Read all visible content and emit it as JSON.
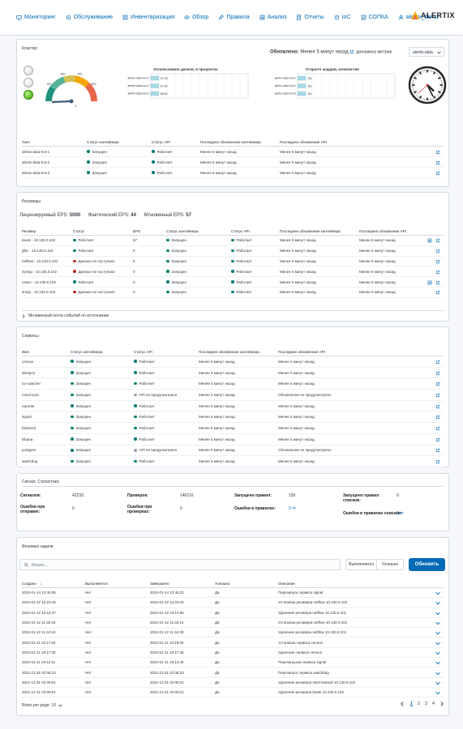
{
  "nav": {
    "items": [
      {
        "label": "Мониторинг",
        "icon": "monitor-icon"
      },
      {
        "label": "Обслуживание",
        "icon": "wrench-icon"
      },
      {
        "label": "Инвентаризация",
        "icon": "inventory-icon"
      },
      {
        "label": "Обзор",
        "icon": "eye-icon"
      },
      {
        "label": "Правила",
        "icon": "pencil-icon"
      },
      {
        "label": "Анализ",
        "icon": "analysis-icon"
      },
      {
        "label": "Отчеты",
        "icon": "report-icon"
      },
      {
        "label": "IoC",
        "icon": "ioc-icon"
      },
      {
        "label": "СОПКА",
        "icon": "sopka-icon"
      },
      {
        "label": "alertix_demo",
        "icon": "user-icon"
      }
    ],
    "brand": "ALERTIX",
    "colors": {
      "link": "#006bb4",
      "brand_orange": "#f5a700",
      "brand_red": "#e7664c"
    }
  },
  "cluster": {
    "title": "Кластер",
    "updated_label": "Обновлено:",
    "updated_value": "Менее 5 минут назад",
    "dynamics_label": "динамика метрик",
    "select_value": "alertix-data",
    "gauge": {
      "ticks": [
        "200",
        "400",
        "600",
        "800"
      ],
      "min_label": "0",
      "value": 0
    },
    "disk_chart": {
      "title": "Использовано дисков, в процентах",
      "categories": [
        "alertix-data-hot-1",
        "alertix-data-hot-2",
        "alertix-data-hot-3"
      ],
      "values": [
        "57.90",
        "57.60",
        "56.60"
      ]
    },
    "shard_chart": {
      "title": "Открыто шардов, количество",
      "categories": [
        "alertix-data-hot-1",
        "alertix-data-hot-2",
        "alertix-data-hot-3"
      ],
      "values": [
        "151",
        "151",
        "151"
      ]
    },
    "clock": {
      "hour": 4,
      "minute": 25,
      "second": 38
    },
    "headers": [
      "Узел",
      "Статус контейнера",
      "Статус API",
      "Последнее обновление контейнера",
      "Последнее обновление API"
    ],
    "rows": [
      [
        "alertix-data-hot-1",
        "Запущен",
        "Работает",
        "Менее 5 минут назад",
        "Менее 5 минут назад"
      ],
      [
        "alertix-data-hot-2",
        "Запущен",
        "Работает",
        "Менее 5 минут назад",
        "Менее 5 минут назад"
      ],
      [
        "alertix-data-hot-3",
        "Запущен",
        "Работает",
        "Менее 5 минут назад",
        "Менее 5 минут назад"
      ]
    ]
  },
  "receivers": {
    "title": "Ресиверы",
    "licensed_label": "Лицензируемый EPS:",
    "licensed_value": "5000",
    "actual_label": "Фактический EPS:",
    "actual_value": "44",
    "instant_label": "Мгновенный EPS:",
    "instant_value": "57",
    "headers": [
      "Ресивер",
      "Статус",
      "EPS",
      "Статус контейнера",
      "Статус API",
      "Последнее обновление контейнера",
      "Последнее обновление API"
    ],
    "rows": [
      {
        "cells": [
          "beats - 10.130.0.102",
          "Работает",
          "57",
          "Запущен",
          "Работает",
          "Менее 5 минут назад",
          "Менее 5 минут назад"
        ],
        "status": "ok",
        "extra_icon": true
      },
      {
        "cells": [
          "jdbc - 10.130.0.102",
          "Работает",
          "0",
          "Запущен",
          "Работает",
          "Менее 5 минут назад",
          "Менее 5 минут назад"
        ],
        "status": "ok",
        "extra_icon": false
      },
      {
        "cells": [
          "netflow - 10.130.0.102",
          "Данные не поступают",
          "0",
          "Запущен",
          "Работает",
          "Менее 5 минут назад",
          "Менее 5 минут назад"
        ],
        "status": "err",
        "extra_icon": false
      },
      {
        "cells": [
          "syslog - 10.130.0.102",
          "Данные не поступают",
          "0",
          "Запущен",
          "Работает",
          "Менее 5 минут назад",
          "Менее 5 минут назад"
        ],
        "status": "err",
        "extra_icon": false
      },
      {
        "cells": [
          "ossec - 10.130.0.102",
          "Работает",
          "0",
          "Запущен",
          "Работает",
          "Менее 5 минут назад",
          "Менее 5 минут назад"
        ],
        "status": "ok",
        "extra_icon": true
      },
      {
        "cells": [
          "snmp - 10.130.0.102",
          "Данные не поступают",
          "0",
          "Запущен",
          "Работает",
          "Менее 5 минут назад",
          "Менее 5 минут назад"
        ],
        "status": "err",
        "extra_icon": false
      }
    ],
    "stream_label": "Мгновенный поток событий по источникам"
  },
  "services": {
    "title": "Сервисы",
    "headers": [
      "Имя",
      "Статус контейнера",
      "Статус API",
      "Последнее обновление контейнера",
      "Последнее обновление API"
    ],
    "rows": [
      {
        "cells": [
          "census",
          "Запущен",
          "Работает",
          "Менее 5 минут назад",
          "Менее 5 минут назад"
        ],
        "api": "ok"
      },
      {
        "cells": [
          "alertprix",
          "Запущен",
          "Работает",
          "Менее 5 минут назад",
          "Менее 5 минут назад"
        ],
        "api": "ok"
      },
      {
        "cells": [
          "ioc-watcher",
          "Запущен",
          "Работает",
          "Менее 5 минут назад",
          "Менее 5 минут назад"
        ],
        "api": "ok"
      },
      {
        "cells": [
          "mssd-sync",
          "Запущен",
          "API не предусмотрено",
          "Менее 5 минут назад",
          "Обновление не предусмотрено"
        ],
        "api": "na"
      },
      {
        "cells": [
          "reporter",
          "Запущен",
          "Работает",
          "Менее 5 минут назад",
          "Менее 5 минут назад"
        ],
        "api": "ok"
      },
      {
        "cells": [
          "signal",
          "Запущен",
          "Работает",
          "Менее 5 минут назад",
          "Менее 5 минут назад"
        ],
        "api": "ok"
      },
      {
        "cells": [
          "backend",
          "Запущен",
          "Работает",
          "Менее 5 минут назад",
          "Менее 5 минут назад"
        ],
        "api": "ok"
      },
      {
        "cells": [
          "kibana",
          "Запущен",
          "Работает",
          "Менее 5 минут назад",
          "Менее 5 минут назад"
        ],
        "api": "ok"
      },
      {
        "cells": [
          "postgres",
          "Запущен",
          "API не предусмотрено",
          "Менее 5 минут назад",
          "Обновление не предусмотрено"
        ],
        "api": "na"
      },
      {
        "cells": [
          "watchdog",
          "Запущен",
          "Работает",
          "Менее 5 минут назад",
          "Менее 5 минут назад"
        ],
        "api": "ok"
      }
    ]
  },
  "signal_stats": {
    "title": "Сигнал. Статистика",
    "signals_label": "Сигналов:",
    "signals_value": "42233",
    "checks_label": "Проверок:",
    "checks_value": "146216",
    "rules_started_label": "Запущено правил:",
    "rules_started_value": "156",
    "rule_lists_label": "Запущено правил списков:",
    "rule_lists_value": "0",
    "send_errors_label": "Ошибки при отправке:",
    "send_errors_value": "0",
    "check_errors_label": "Ошибки при проверках:",
    "check_errors_value": "0",
    "rule_errors_label": "Ошибки в правилах:",
    "rule_errors_value": "0",
    "list_errors_label": "Ошибки в правилах списков:",
    "list_errors_value": "0"
  },
  "bg_tasks": {
    "title": "Фоновые задачи",
    "search_placeholder": "Искать ...",
    "filter_running": "Выполняется",
    "filter_success": "Успешно",
    "refresh_label": "Обновить",
    "headers": [
      "Создано",
      "Выполняется",
      "Завершено",
      "Успешно",
      "Описание"
    ],
    "sort_arrow": "↓",
    "rows": [
      [
        "2022-01-14 13:45:06",
        "Нет",
        "2022-01-14 13:45:22",
        "Да",
        "Перезапуск сервиса signal"
      ],
      [
        "2022-01-12 12:23:18",
        "Нет",
        "2022-01-12 12:23:44",
        "Да",
        "Установка ресивера netflow 10.130.0.102"
      ],
      [
        "2022-01-12 12:14:47",
        "Нет",
        "2022-01-12 12:14:55",
        "Да",
        "Удаление ресивера netflow 10.130.0.101"
      ],
      [
        "2022-01-12 11:45:18",
        "Нет",
        "2022-01-12 11:46:12",
        "Да",
        "Установка ресивера netflow 10.130.0.101"
      ],
      [
        "2022-01-12 11:44:23",
        "Нет",
        "2022-01-12 11:44:39",
        "Да",
        "Удаление ресивера netflow 10.130.0.101"
      ],
      [
        "2022-01-11 19:17:53",
        "Нет",
        "2022-01-11 19:18:06",
        "Да",
        "Установка сервиса census"
      ],
      [
        "2022-01-11 19:17:30",
        "Нет",
        "2022-01-11 19:17:45",
        "Да",
        "Удаление сервиса census"
      ],
      [
        "2022-01-11 19:12:11",
        "Нет",
        "2022-01-11 19:12:45",
        "Да",
        "Перезагрузка сервиса signal"
      ],
      [
        "2021-12-31 02:08:10",
        "Нет",
        "2021-12-31 02:08:33",
        "Да",
        "Перезапуск сервиса watchdog"
      ],
      [
        "2021-12-31 02:09:01",
        "Нет",
        "2021-12-31 02:09:21",
        "Да",
        "Удаление ресивера stormwatwaf 10.130.0.102"
      ],
      [
        "2021-12-31 02:09:01",
        "Нет",
        "2021-12-31 02:09:21",
        "Да",
        "Удаление ресивера beats 10.130.0.102"
      ]
    ],
    "rows_per_page_label": "Rows per page: 10",
    "pages": [
      "1",
      "2",
      "3",
      "4"
    ],
    "current_page": "1"
  }
}
